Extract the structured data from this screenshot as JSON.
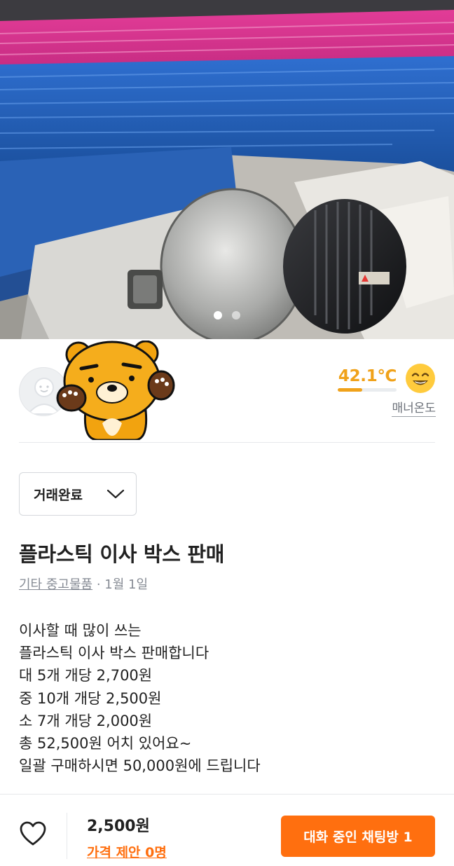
{
  "photo": {
    "carousel_count": 2,
    "active_index": 0
  },
  "seller": {
    "temperature": "42.1℃",
    "temperature_ratio": 0.421,
    "temperature_caption": "매너온도",
    "temperature_color": "#f0a21a",
    "face_icon": "smiling-face-icon",
    "avatar_icon": "default-avatar-icon",
    "sticker_icon": "bear-character-sticker"
  },
  "status": {
    "selected": "거래완료"
  },
  "post": {
    "title": "플라스틱 이사 박스 판매",
    "category": "기타 중고물품",
    "separator": " · ",
    "time": "1월 1일",
    "description_lines": [
      "이사할 때 많이 쓰는",
      "플라스틱 이사 박스 판매합니다",
      "대 5개 개당 2,700원",
      "중 10개 개당 2,500원",
      "소 7개 개당 2,000원",
      "총 52,500원 어치 있어요~",
      "일괄 구매하시면 50,000원에 드립니다"
    ]
  },
  "footer": {
    "price": "2,500원",
    "price_offer": "가격 제안 0명",
    "chat_button": "대화 중인 채팅방 1",
    "accent_color": "#ff6f0f",
    "like_icon": "heart-outline-icon"
  }
}
